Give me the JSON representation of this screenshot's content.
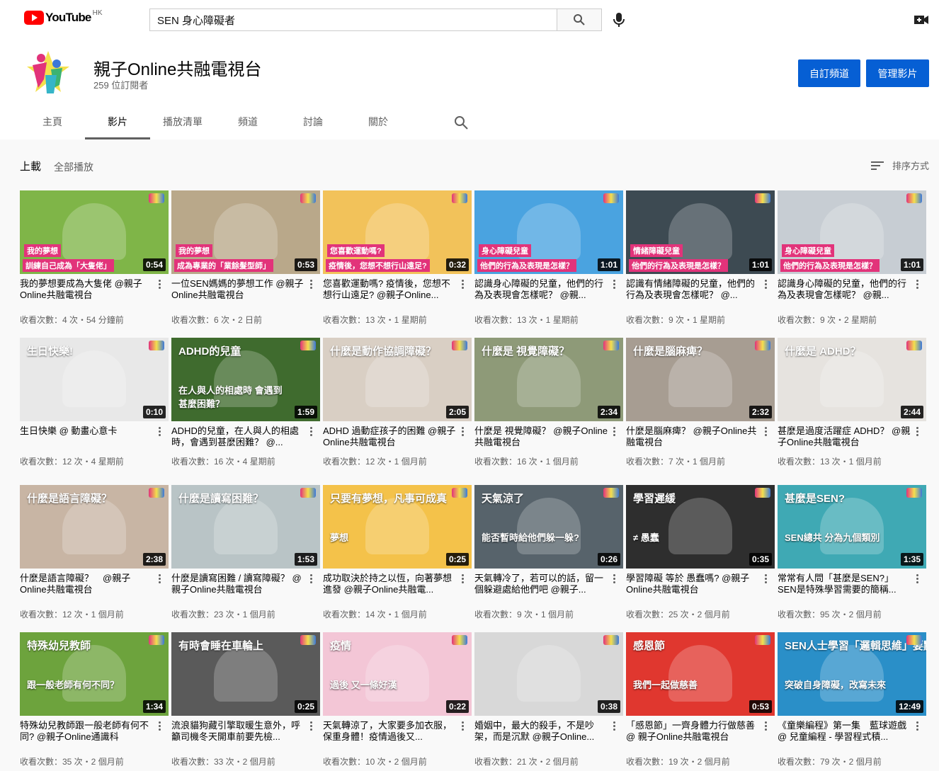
{
  "topbar": {
    "logo_text": "YouTube",
    "region": "HK",
    "search_value": "SEN 身心障礙者"
  },
  "channel": {
    "name": "親子Online共融電視台",
    "subscribers": "259 位訂閱者",
    "customize_button": "自訂頻道",
    "manage_button": "管理影片"
  },
  "tabs": [
    "主頁",
    "影片",
    "播放清單",
    "頻道",
    "討論",
    "關於"
  ],
  "section": {
    "title": "上載",
    "play_all": "全部播放",
    "sort_label": "排序方式"
  },
  "videos": [
    {
      "title": "我的夢想要成為大隻佬 @親子Online共融電視台",
      "meta": "收看次數：4 次・54 分鐘前",
      "duration": "0:54",
      "bg": "#7fb548",
      "caption1": "我的夢想",
      "caption2": "訓練自己成為「大隻佬」"
    },
    {
      "title": "一位SEN媽媽的夢想工作 @親子Online共融電視台",
      "meta": "收看次數：6 次・2 日前",
      "duration": "0:53",
      "bg": "#b9a88a",
      "caption1": "我的夢想",
      "caption2": "成為專業的「業餘髮型師」"
    },
    {
      "title": "您喜歡運動嗎? 疫情後，您想不想行山遠足? @親子Online...",
      "meta": "收看次數：13 次・1 星期前",
      "duration": "0:32",
      "bg": "#f2c25a",
      "caption1": "您喜歡運動嗎?",
      "caption2": "疫情後，您想不想行山遠足?"
    },
    {
      "title": "認識身心障礙的兒童，他們的行為及表現會怎樣呢？ @親...",
      "meta": "收看次數：13 次・1 星期前",
      "duration": "1:01",
      "bg": "#4aa3e0",
      "caption1": "身心障礙兒童",
      "caption2": "他們的行為及表現是怎樣？"
    },
    {
      "title": "認識有情緒障礙的兒童，他們的行為及表現會怎樣呢？ @...",
      "meta": "收看次數：9 次・1 星期前",
      "duration": "1:01",
      "bg": "#3d4a52",
      "caption1": "情緒障礙兒童",
      "caption2": "他們的行為及表現是怎樣？"
    },
    {
      "title": "認識身心障礙的兒童，他們的行為及表現會怎樣呢？ @親...",
      "meta": "收看次數：9 次・2 星期前",
      "duration": "1:01",
      "bg": "#c7cdd3",
      "caption1": "身心障礙兒童",
      "caption2": "他們的行為及表現是怎樣？"
    },
    {
      "title": "生日快樂 @ 動畫心意卡",
      "meta": "收看次數：12 次・4 星期前",
      "duration": "0:10",
      "bg": "#e8e8e8",
      "caption1": "生日快樂!",
      "caption2": ""
    },
    {
      "title": "ADHD的兒童，在人與人的相處時，會遇到甚麼困難？ @...",
      "meta": "收看次數：16 次・4 星期前",
      "duration": "1:59",
      "bg": "#3f6b2e",
      "caption1": "ADHD的兒童",
      "caption2": "在人與人的相處時 會遇到甚麼困難？"
    },
    {
      "title": "ADHD 過動症孩子的困難 @親子Online共融電視台",
      "meta": "收看次數：12 次・1 個月前",
      "duration": "2:05",
      "bg": "#d9cfc4",
      "caption1": "什麼是動作協調障礙？",
      "caption2": ""
    },
    {
      "title": "什麼是 視覺障礙？ @親子Online共融電視台",
      "meta": "收看次數：16 次・1 個月前",
      "duration": "2:34",
      "bg": "#8e9a78",
      "caption1": "什麼是 視覺障礙？",
      "caption2": ""
    },
    {
      "title": "什麼是腦麻痺？ @親子Online共融電視台",
      "meta": "收看次數：7 次・1 個月前",
      "duration": "2:32",
      "bg": "#a79d92",
      "caption1": "什麼是腦麻痺？",
      "caption2": ""
    },
    {
      "title": "甚麼是過度活躍症 ADHD？ @親子Online共融電視台",
      "meta": "收看次數：13 次・1 個月前",
      "duration": "2:44",
      "bg": "#e6e3df",
      "caption1": "什麼是 ADHD？",
      "caption2": ""
    },
    {
      "title": "什麼是語言障礙？　@親子Online共融電視台",
      "meta": "收看次數：12 次・1 個月前",
      "duration": "2:38",
      "bg": "#c8b5a4",
      "caption1": "什麼是語言障礙？",
      "caption2": ""
    },
    {
      "title": "什麼是讀寫困難 / 讀寫障礙？ @親子Online共融電視台",
      "meta": "收看次數：23 次・1 個月前",
      "duration": "1:53",
      "bg": "#b9c4c6",
      "caption1": "什麼是讀寫困難？",
      "caption2": ""
    },
    {
      "title": "成功取決於持之以恆，向著夢想進發 @親子Online共融電...",
      "meta": "收看次數：14 次・1 個月前",
      "duration": "0:25",
      "bg": "#f4c24a",
      "caption1": "只要有夢想，凡事可成真",
      "caption2": "夢想"
    },
    {
      "title": "天氣轉冷了，若可以的話，留一個躲避處給他們吧 @親子...",
      "meta": "收看次數：9 次・1 個月前",
      "duration": "0:26",
      "bg": "#57636b",
      "caption1": "天氣涼了",
      "caption2": "能否暫時給他們躲一躲?"
    },
    {
      "title": "學習障礙 等於 愚蠢嗎? @親子Online共融電視台",
      "meta": "收看次數：25 次・2 個月前",
      "duration": "0:35",
      "bg": "#2e2e2e",
      "caption1": "學習遲緩",
      "caption2": "≠ 愚蠢"
    },
    {
      "title": "常常有人問「甚麼是SEN?」SEN是特殊學習需要的簡稱...",
      "meta": "收看次數：95 次・2 個月前",
      "duration": "1:35",
      "bg": "#3fa9b4",
      "caption1": "甚麼是SEN?",
      "caption2": "SEN總共 分為九個類別"
    },
    {
      "title": "特殊幼兒教師跟一般老師有何不同? @親子Online通識科",
      "meta": "收看次數：35 次・2 個月前",
      "duration": "1:34",
      "bg": "#6da33d",
      "caption1": "特殊幼兒教師",
      "caption2": "跟一般老師有何不同？"
    },
    {
      "title": "流浪貓狗藏引擎取暖生意外，呼籲司機冬天開車前要先檢...",
      "meta": "收看次數：33 次・2 個月前",
      "duration": "0:25",
      "bg": "#5a5a5a",
      "caption1": "有時會睡在車輪上",
      "caption2": ""
    },
    {
      "title": "天氣轉涼了，大家要多加衣服，保重身體！疫情過後又...",
      "meta": "收看次數：10 次・2 個月前",
      "duration": "0:22",
      "bg": "#f3c6d6",
      "caption1": "疫情",
      "caption2": "過後 又一條好漢"
    },
    {
      "title": "婚姻中，最大的殺手，不是吵架，而是沉默 @親子Online...",
      "meta": "收看次數：21 次・2 個月前",
      "duration": "0:38",
      "bg": "#d8d8d8",
      "caption1": "",
      "caption2": ""
    },
    {
      "title": "「感恩節」一齊身體力行做慈善 @ 親子Online共融電視台",
      "meta": "收看次數：19 次・2 個月前",
      "duration": "0:53",
      "bg": "#e0372f",
      "caption1": "感恩節",
      "caption2": "我們一起做慈善"
    },
    {
      "title": "《童樂編程》第一集　藍球遊戲 @ 兒童編程 - 學習程式積...",
      "meta": "收看次數：79 次・2 個月前",
      "duration": "12:49",
      "bg": "#2a8fc8",
      "caption1": "SEN人士學習「邏輯思維」要點：",
      "caption2": "突破自身障礙，改寫未來"
    }
  ]
}
